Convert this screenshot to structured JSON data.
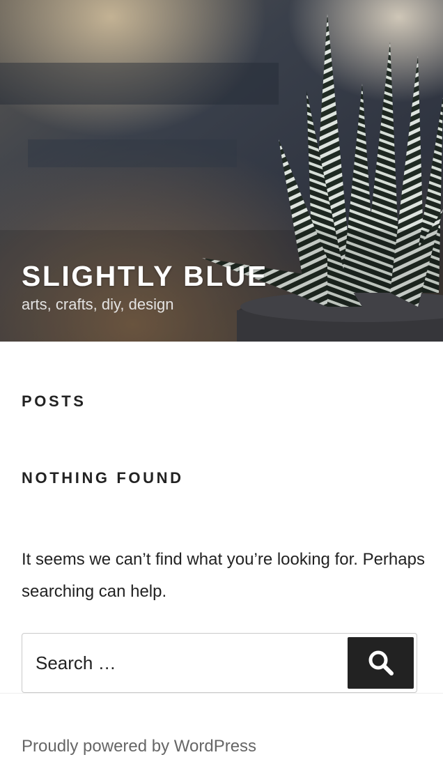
{
  "header": {
    "site_title": "SLIGHTLY BLUE",
    "site_description": "arts, crafts, diy, design"
  },
  "main": {
    "posts_heading": "POSTS",
    "nothing_found_heading": "NOTHING FOUND",
    "message": "It seems we can’t find what you’re looking for. Perhaps searching can help."
  },
  "search": {
    "placeholder": "Search …",
    "button_icon": "search-icon"
  },
  "footer": {
    "credit": "Proudly powered by WordPress"
  },
  "colors": {
    "text": "#222222",
    "footer_text": "#666666",
    "button_bg": "#222222",
    "background": "#ffffff",
    "border": "#c9c9c9"
  }
}
